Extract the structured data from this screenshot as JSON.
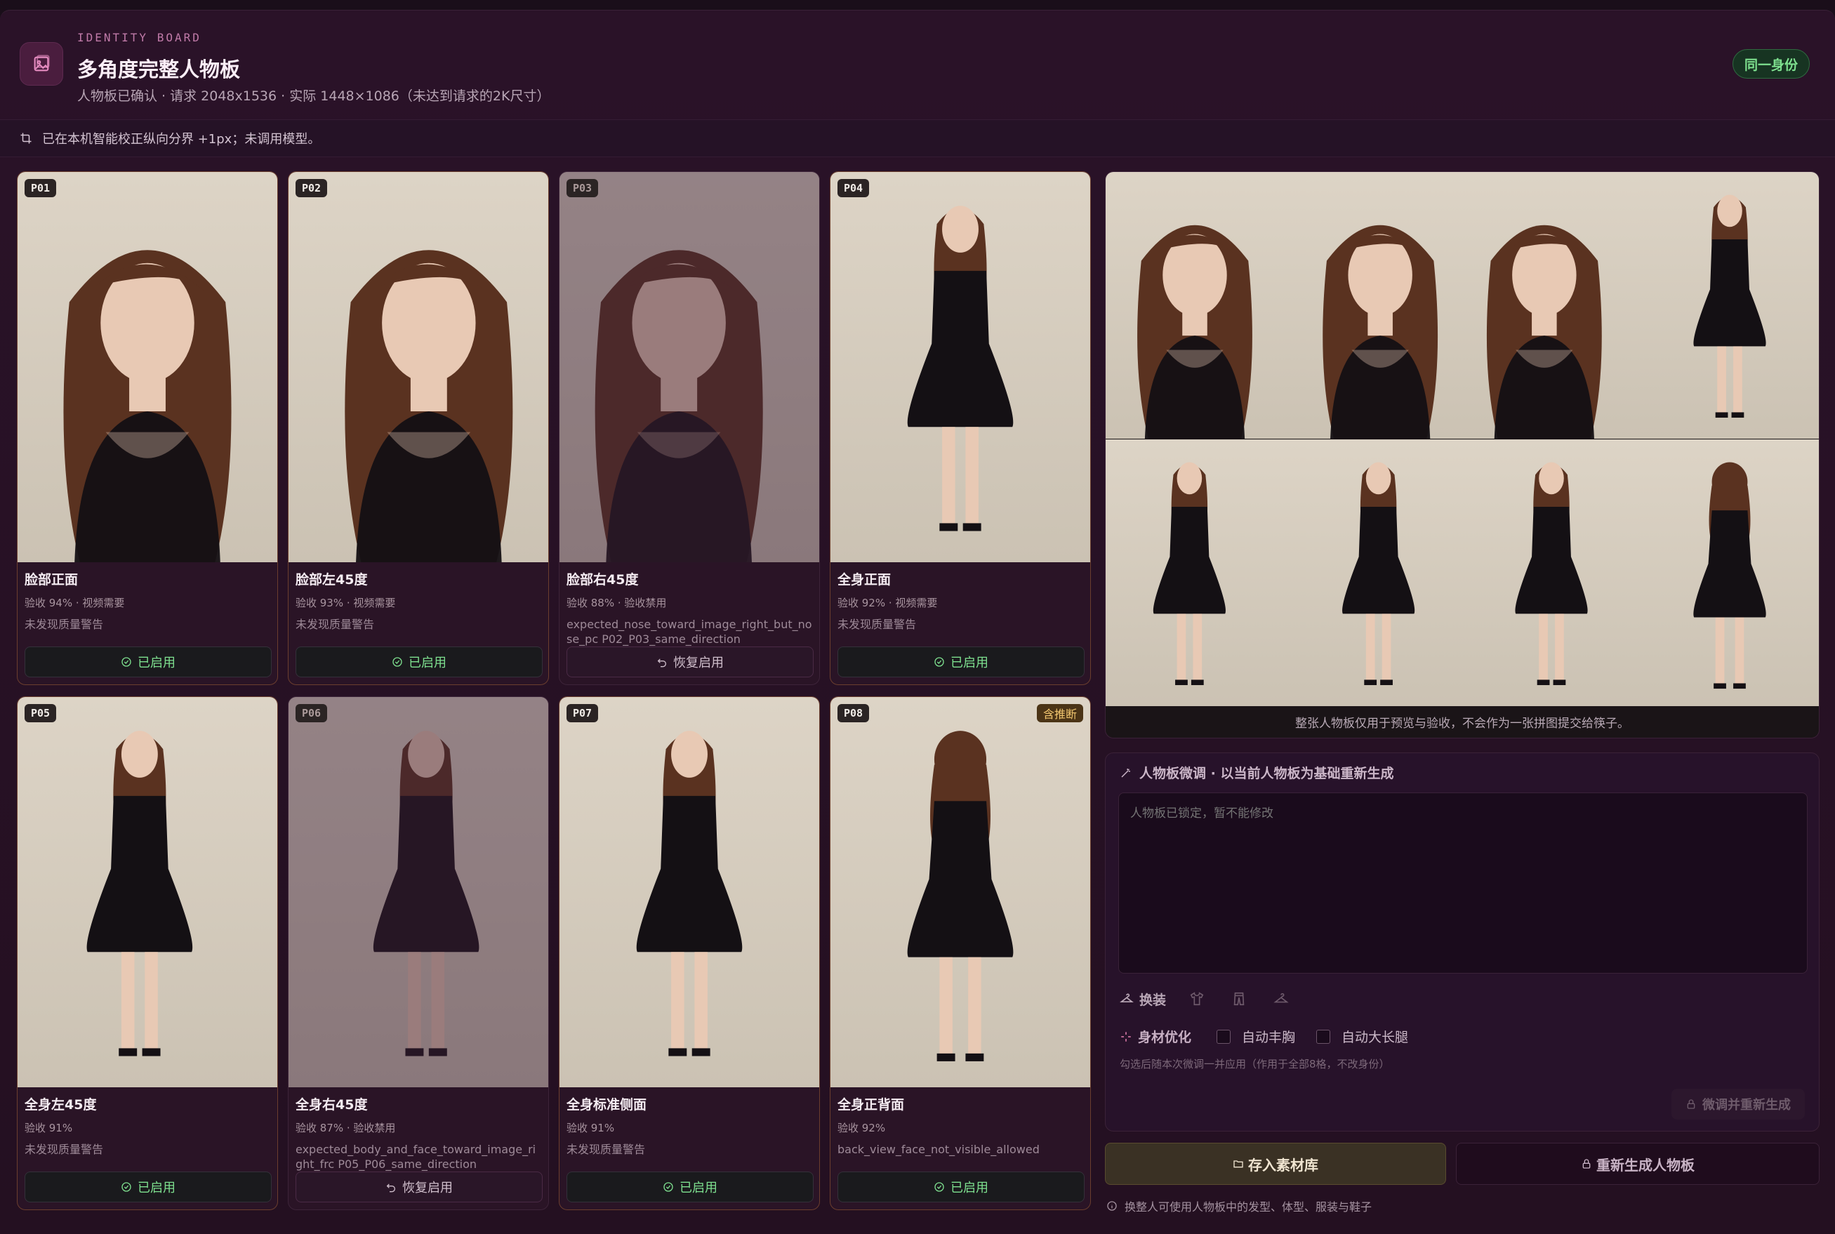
{
  "header": {
    "eyebrow": "IDENTITY BOARD",
    "title": "多角度完整人物板",
    "subtitle": "人物板已确认 · 请求 2048x1536 · 实际 1448×1086（未达到请求的2K尺寸）",
    "badge": "同一身份",
    "logo_icon": "image-icon"
  },
  "notice": {
    "text": "已在本机智能校正纵向分界 +1px；未调用模型。",
    "icon": "crop-icon"
  },
  "cards": [
    {
      "tag": "P01",
      "name": "脸部正面",
      "meta": "验收 94% · 视频需要",
      "warn": "未发现质量警告",
      "button": "已启用",
      "enabled": true,
      "pose": "face-front"
    },
    {
      "tag": "P02",
      "name": "脸部左45度",
      "meta": "验收 93% · 视频需要",
      "warn": "未发现质量警告",
      "button": "已启用",
      "enabled": true,
      "pose": "face-left"
    },
    {
      "tag": "P03",
      "name": "脸部右45度",
      "meta": "验收 88% · 验收禁用",
      "warn": "expected_nose_toward_image_right_but_nose_pc P02_P03_same_direction",
      "button": "恢复启用",
      "enabled": false,
      "pose": "face-right"
    },
    {
      "tag": "P04",
      "name": "全身正面",
      "meta": "验收 92% · 视频需要",
      "warn": "未发现质量警告",
      "button": "已启用",
      "enabled": true,
      "pose": "body-front"
    },
    {
      "tag": "P05",
      "name": "全身左45度",
      "meta": "验收 91%",
      "warn": "未发现质量警告",
      "button": "已启用",
      "enabled": true,
      "pose": "body-left"
    },
    {
      "tag": "P06",
      "name": "全身右45度",
      "meta": "验收 87% · 验收禁用",
      "warn": "expected_body_and_face_toward_image_right_frc P05_P06_same_direction",
      "button": "恢复启用",
      "enabled": false,
      "pose": "body-right"
    },
    {
      "tag": "P07",
      "name": "全身标准侧面",
      "meta": "验收 91%",
      "warn": "未发现质量警告",
      "button": "已启用",
      "enabled": true,
      "pose": "body-side"
    },
    {
      "tag": "P08",
      "name": "全身正背面",
      "meta": "验收 92%",
      "warn": "back_view_face_not_visible_allowed",
      "button": "已启用",
      "enabled": true,
      "pose": "body-back",
      "extra_tag": "含推断"
    }
  ],
  "preview": {
    "caption": "整张人物板仅用于预览与验收，不会作为一张拼图提交给筷子。"
  },
  "edit": {
    "title": "人物板微调 · 以当前人物板为基础重新生成",
    "placeholder": "人物板已锁定，暂不能修改",
    "outfit_label": "换装",
    "body_label": "身材优化",
    "opt_bust": "自动丰胸",
    "opt_legs": "自动大长腿",
    "hint": "勾选后随本次微调一并应用（作用于全部8格，不改身份）",
    "regen_button": "微调并重新生成"
  },
  "actions": {
    "save": "存入素材库",
    "rebuild": "重新生成人物板",
    "footnote": "换整人可使用人物板中的发型、体型、服装与鞋子"
  },
  "colors": {
    "accent_green": "#7ee08f",
    "warn_amber": "#f0c56e",
    "bg": "#1a0e1a"
  }
}
